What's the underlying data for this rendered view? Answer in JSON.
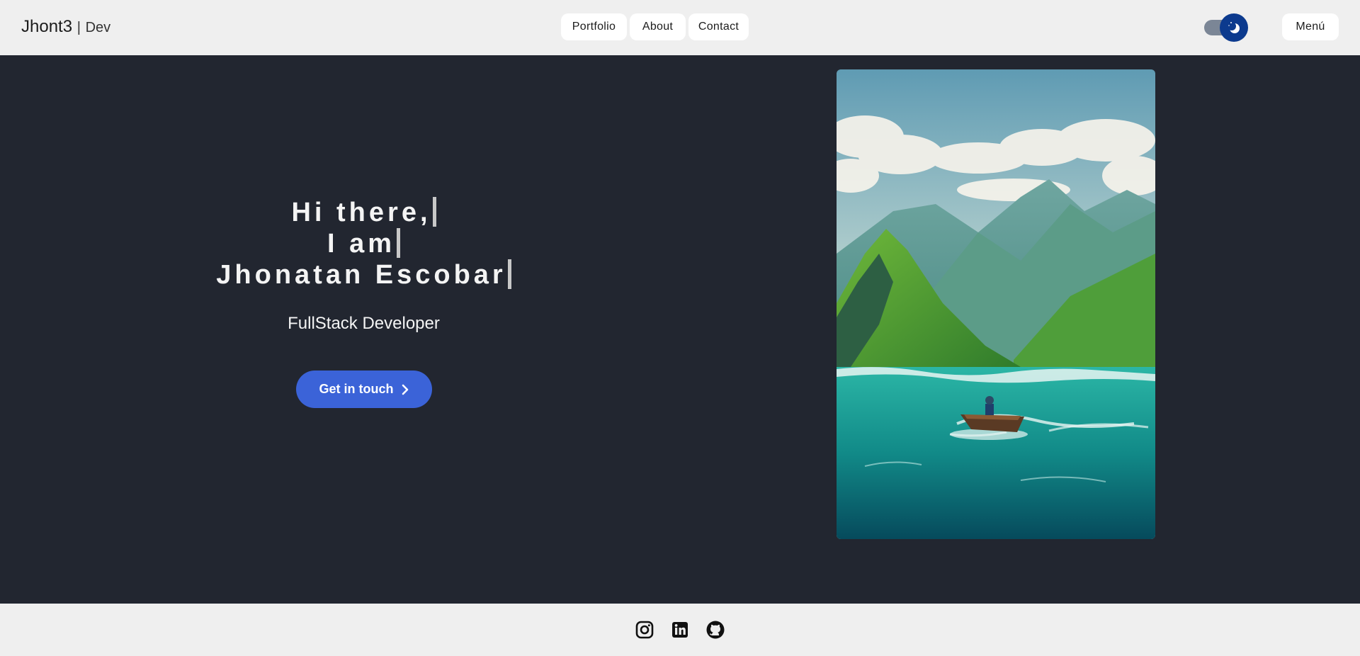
{
  "header": {
    "brand": "Jhont3",
    "brand_separator": "|",
    "brand_sub": "Dev",
    "nav": [
      {
        "label": "Portfolio",
        "icon": ""
      },
      {
        "label": "About",
        "icon": ""
      },
      {
        "label": "Contact",
        "icon": ""
      }
    ],
    "theme_toggle_icon": "moon-icon",
    "menu_label": "Menú"
  },
  "hero": {
    "line1": "Hi there,",
    "line2": "I am",
    "line3": "Jhonatan Escobar",
    "role": "FullStack Developer",
    "cta_label": "Get in touch",
    "cta_icon": "chevron-right-icon",
    "image_subject": "boat-mountains-illustration"
  },
  "footer": {
    "social": [
      {
        "icon": "instagram-icon"
      },
      {
        "icon": "linkedin-icon"
      },
      {
        "icon": "github-icon"
      }
    ]
  },
  "colors": {
    "header_bg": "#efefef",
    "page_bg": "#222630",
    "accent": "#3b63d8",
    "toggle_knob": "#0c3a8e"
  }
}
